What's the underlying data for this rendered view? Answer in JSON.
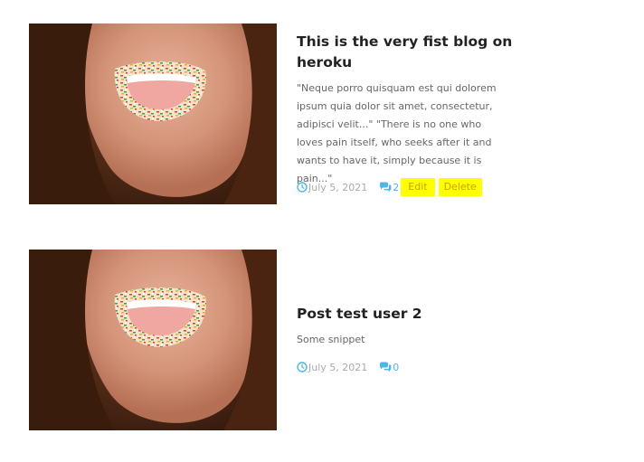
{
  "posts": [
    {
      "title": "This is the very fist blog on heroku",
      "excerpt": "\"Neque porro quisquam est qui dolorem ipsum quia dolor sit amet, consectetur, adipisci velit...\" \"There is no one who loves pain itself, who seeks after it and wants to have it, simply because it is pain...\"",
      "date": "July 5, 2021",
      "comments": "2",
      "edit_label": "Edit",
      "delete_label": "Delete"
    },
    {
      "title": "Post test user 2",
      "excerpt": "Some snippet",
      "date": "July 5, 2021",
      "comments": "0"
    }
  ],
  "icons": {
    "date": "clock-icon",
    "comments": "comments-icon"
  },
  "colors": {
    "accent": "#4fb7e6",
    "highlight": "#ffff00",
    "title": "#222222",
    "text": "#666666"
  }
}
